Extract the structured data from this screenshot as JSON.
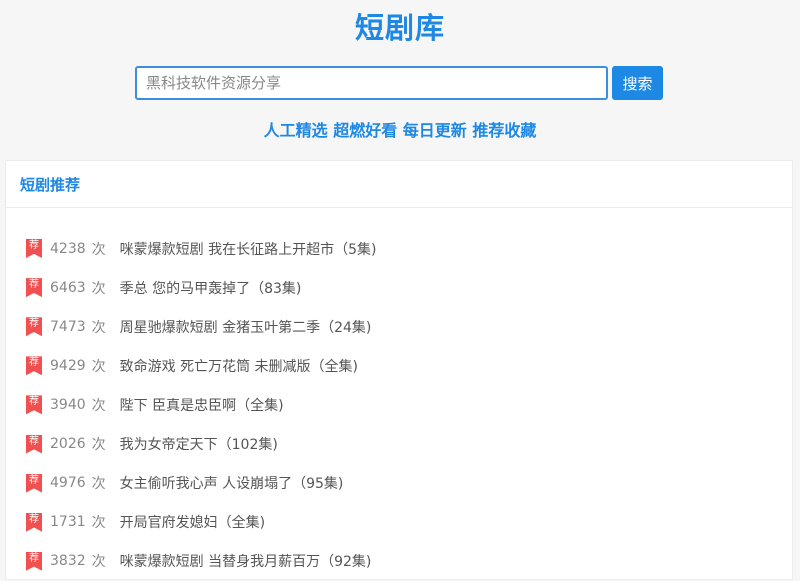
{
  "header": {
    "title": "短剧库",
    "tagline": "人工精选 超燃好看 每日更新 推荐收藏"
  },
  "search": {
    "placeholder": "黑科技软件资源分享",
    "button_label": "搜索"
  },
  "panel": {
    "title": "短剧推荐",
    "count_unit": "次",
    "badge_label": "荐",
    "items": [
      {
        "count": "4238",
        "title": "咪蒙爆款短剧 我在长征路上开超市（5集)"
      },
      {
        "count": "6463",
        "title": "季总 您的马甲轰掉了（83集)"
      },
      {
        "count": "7473",
        "title": "周星驰爆款短剧 金猪玉叶第二季（24集)"
      },
      {
        "count": "9429",
        "title": "致命游戏 死亡万花筒 未删减版（全集)"
      },
      {
        "count": "3940",
        "title": "陛下 臣真是忠臣啊（全集)"
      },
      {
        "count": "2026",
        "title": "我为女帝定天下（102集)"
      },
      {
        "count": "4976",
        "title": "女主偷听我心声 人设崩塌了（95集)"
      },
      {
        "count": "1731",
        "title": "开局官府发媳妇（全集)"
      },
      {
        "count": "3832",
        "title": "咪蒙爆款短剧 当替身我月薪百万（92集)"
      }
    ]
  },
  "colors": {
    "accent": "#1e88e5",
    "badge": "#f05050",
    "text": "#555555",
    "muted": "#888888"
  },
  "icons": {
    "badge": "bookmark-ribbon-icon"
  }
}
